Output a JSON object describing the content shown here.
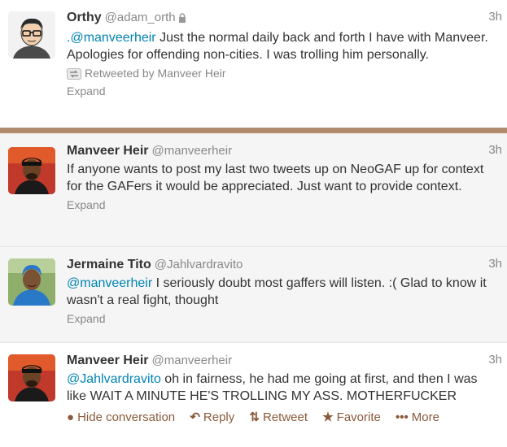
{
  "tweets": [
    {
      "name": "Orthy",
      "handle": "@adam_orth",
      "time": "3h",
      "mention": ".@manveerheir",
      "text": " Just the normal daily back and forth I have with Manveer. Apologies for offending non-cities. I was trolling him personally.",
      "retweeted_by": "Retweeted by Manveer Heir",
      "expand": "Expand"
    },
    {
      "name": "Manveer Heir",
      "handle": "@manveerheir",
      "time": "3h",
      "text": "If anyone wants to post my last two tweets up on NeoGAF up for context for the GAFers it would be appreciated. Just want to provide context.",
      "expand": "Expand"
    },
    {
      "name": "Jermaine Tito",
      "handle": "@Jahlvardravito",
      "time": "3h",
      "mention": "@manveerheir",
      "text": " I seriously doubt most gaffers will listen. :(  Glad to know it wasn't a real fight, thought",
      "expand": "Expand"
    },
    {
      "name": "Manveer Heir",
      "handle": "@manveerheir",
      "time": "3h",
      "mention": "@Jahlvardravito",
      "text": " oh in fairness, he had me going at first, and then I was like WAIT A MINUTE HE'S TROLLING MY ASS. MOTHERFUCKER"
    }
  ],
  "actions": {
    "hide_conversation": "Hide conversation",
    "reply": "Reply",
    "retweet": "Retweet",
    "favorite": "Favorite",
    "more": "More"
  },
  "colors": {
    "link": "#0084b4",
    "action": "#8a5a3a",
    "separator": "#b08b6e"
  },
  "icons": {
    "protected": "lock-icon",
    "retweeted": "retweet-icon",
    "hide": "speech-bubble-icon",
    "reply": "reply-arrow-icon",
    "retweet": "retweet-icon",
    "favorite": "star-icon",
    "more": "dots-icon"
  }
}
